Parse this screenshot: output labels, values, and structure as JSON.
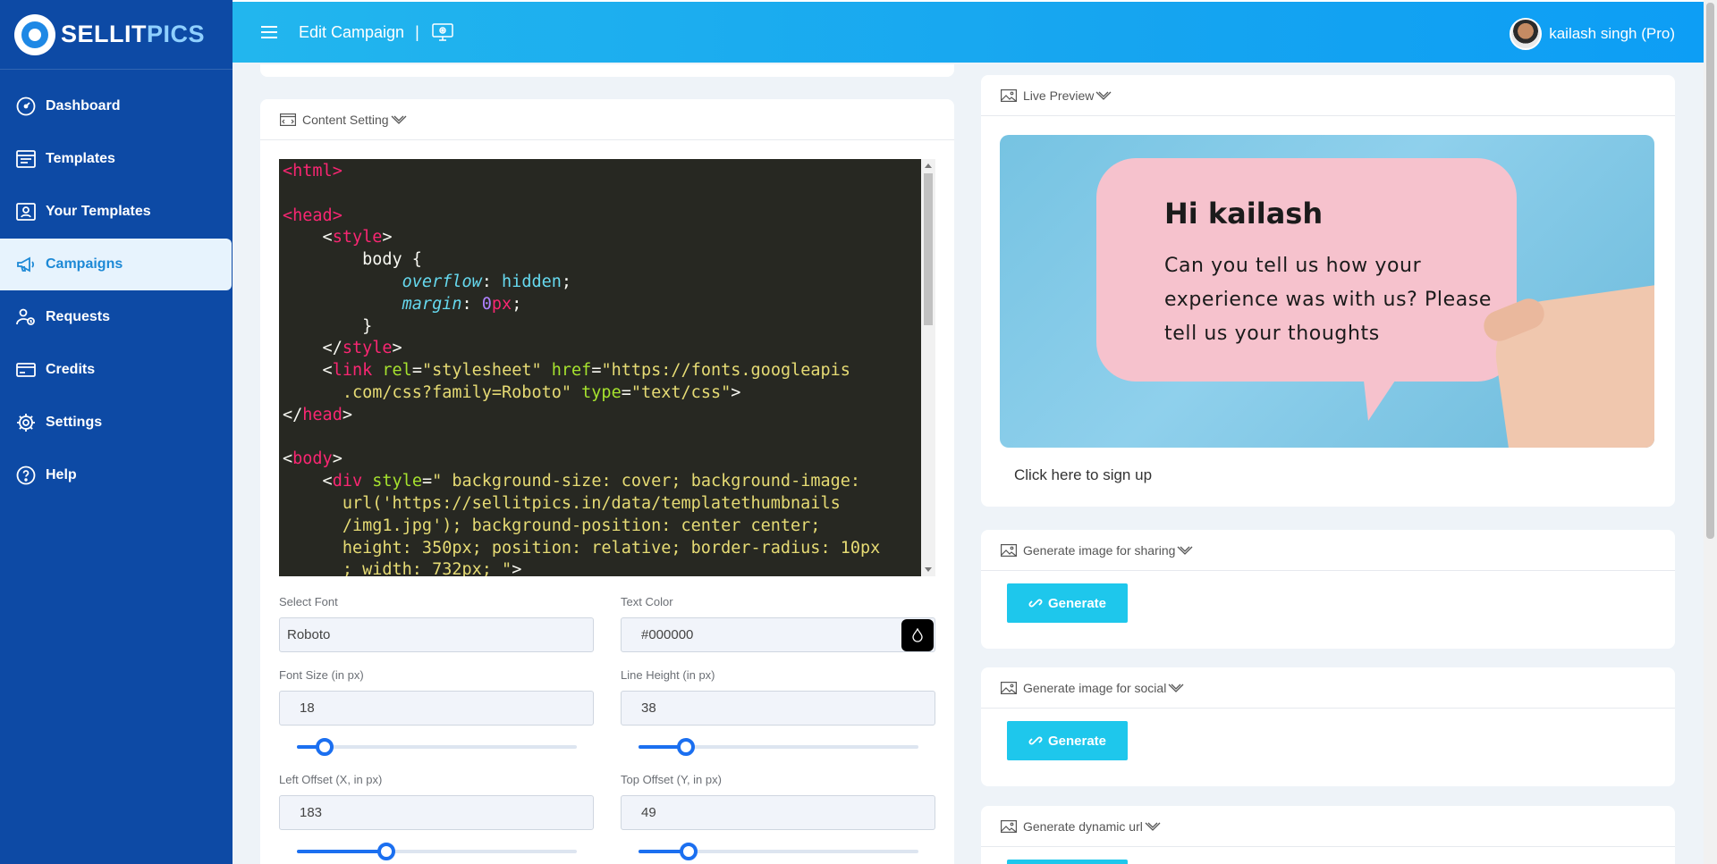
{
  "brand": {
    "part1": "SELLIT",
    "part2": "PICS"
  },
  "sidebar": {
    "items": [
      {
        "label": "Dashboard",
        "icon": "gauge-icon"
      },
      {
        "label": "Templates",
        "icon": "template-icon"
      },
      {
        "label": "Your Templates",
        "icon": "user-template-icon"
      },
      {
        "label": "Campaigns",
        "icon": "megaphone-icon",
        "active": true
      },
      {
        "label": "Requests",
        "icon": "users-request-icon"
      },
      {
        "label": "Credits",
        "icon": "credit-card-icon"
      },
      {
        "label": "Settings",
        "icon": "gear-icon"
      },
      {
        "label": "Help",
        "icon": "help-icon"
      }
    ]
  },
  "header": {
    "title": "Edit Campaign",
    "separator": "|",
    "user": "kailash singh (Pro)"
  },
  "content_setting": {
    "title": "Content Setting",
    "code": [
      "<html>",
      "",
      "<head>",
      "    <style>",
      "        body {",
      "            overflow: hidden;",
      "            margin: 0px;",
      "        }",
      "    </style>",
      "    <link rel=\"stylesheet\" href=\"https://fonts.googleapis",
      "      .com/css?family=Roboto\" type=\"text/css\">",
      "</head>",
      "",
      "<body>",
      "    <div style=\" background-size: cover; background-image:",
      "      url('https://sellitpics.in/data/templatethumbnails",
      "      /img1.jpg'); background-position: center center;",
      "      height: 350px; position: relative; border-radius: 10px",
      "      ; width: 732px; \">"
    ],
    "fields": {
      "font": {
        "label": "Select Font",
        "value": "Roboto"
      },
      "text_color": {
        "label": "Text Color",
        "value": "#000000"
      },
      "font_size": {
        "label": "Font Size (in px)",
        "value": "18",
        "slider_fraction": 0.1
      },
      "line_height": {
        "label": "Line Height (in px)",
        "value": "38",
        "slider_fraction": 0.17
      },
      "left_offset": {
        "label": "Left Offset (X, in px)",
        "value": "183",
        "slider_fraction": 0.32
      },
      "top_offset": {
        "label": "Top Offset (Y, in px)",
        "value": "49",
        "slider_fraction": 0.18
      }
    }
  },
  "live_preview": {
    "title": "Live Preview",
    "heading": "Hi kailash",
    "message": "Can you tell us how your experience was with us? Please tell us your thoughts",
    "link": "Click here to sign up"
  },
  "generate_sections": [
    {
      "title": "Generate image for sharing",
      "button": "Generate"
    },
    {
      "title": "Generate image for social",
      "button": "Generate"
    },
    {
      "title": "Generate dynamic url",
      "button": ""
    }
  ],
  "colors": {
    "sidebar": "#0d4aa5",
    "topbar": "#16a5f0",
    "generate": "#1ec7ec",
    "active_nav": "#e7f3fd"
  }
}
